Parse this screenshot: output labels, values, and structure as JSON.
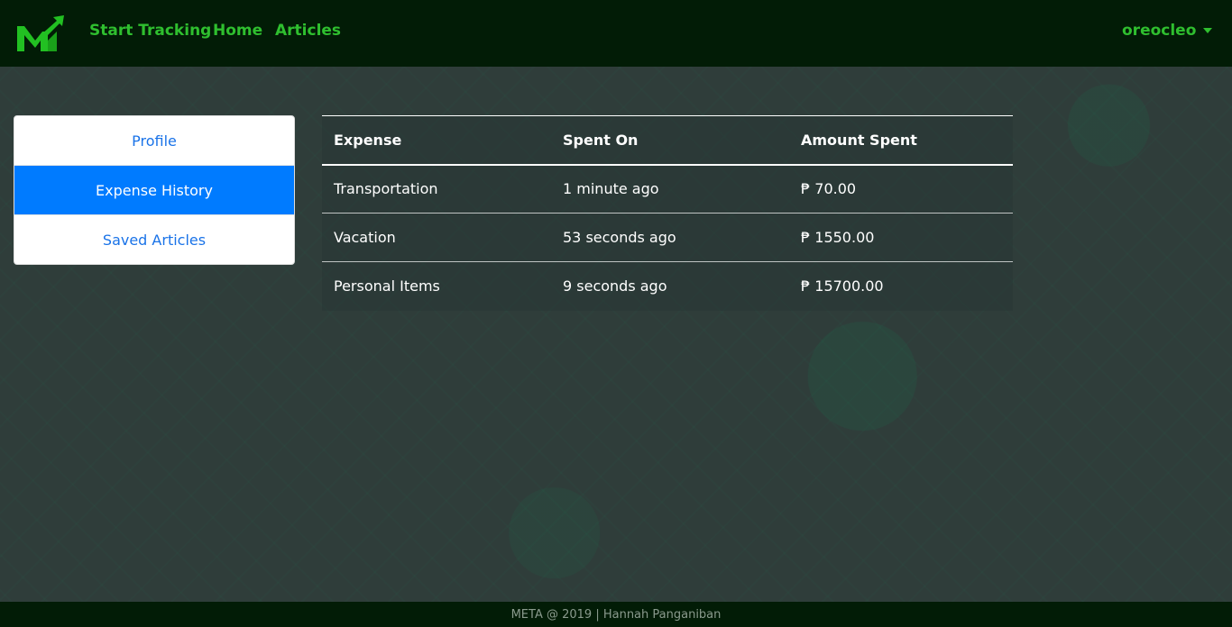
{
  "navbar": {
    "logo_icon": "meta-logo-icon",
    "links": [
      "Start Tracking",
      "Home",
      "Articles"
    ],
    "user": "oreocleo",
    "color": "#2fbf2f",
    "background": "#021c06"
  },
  "sidebar": {
    "items": [
      {
        "label": "Profile"
      },
      {
        "label": "Expense History",
        "active": true
      },
      {
        "label": "Saved Articles"
      }
    ],
    "active_color": "#007bff"
  },
  "table": {
    "headers": [
      "Expense",
      "Spent On",
      "Amount Spent"
    ],
    "rows": [
      [
        "Transportation",
        "1 minute ago",
        "₱ 70.00"
      ],
      [
        "Vacation",
        "53 seconds ago",
        "₱ 1550.00"
      ],
      [
        "Personal Items",
        "9 seconds ago",
        "₱ 15700.00"
      ]
    ]
  },
  "footer": {
    "text": "META @ 2019 | Hannah Panganiban"
  }
}
